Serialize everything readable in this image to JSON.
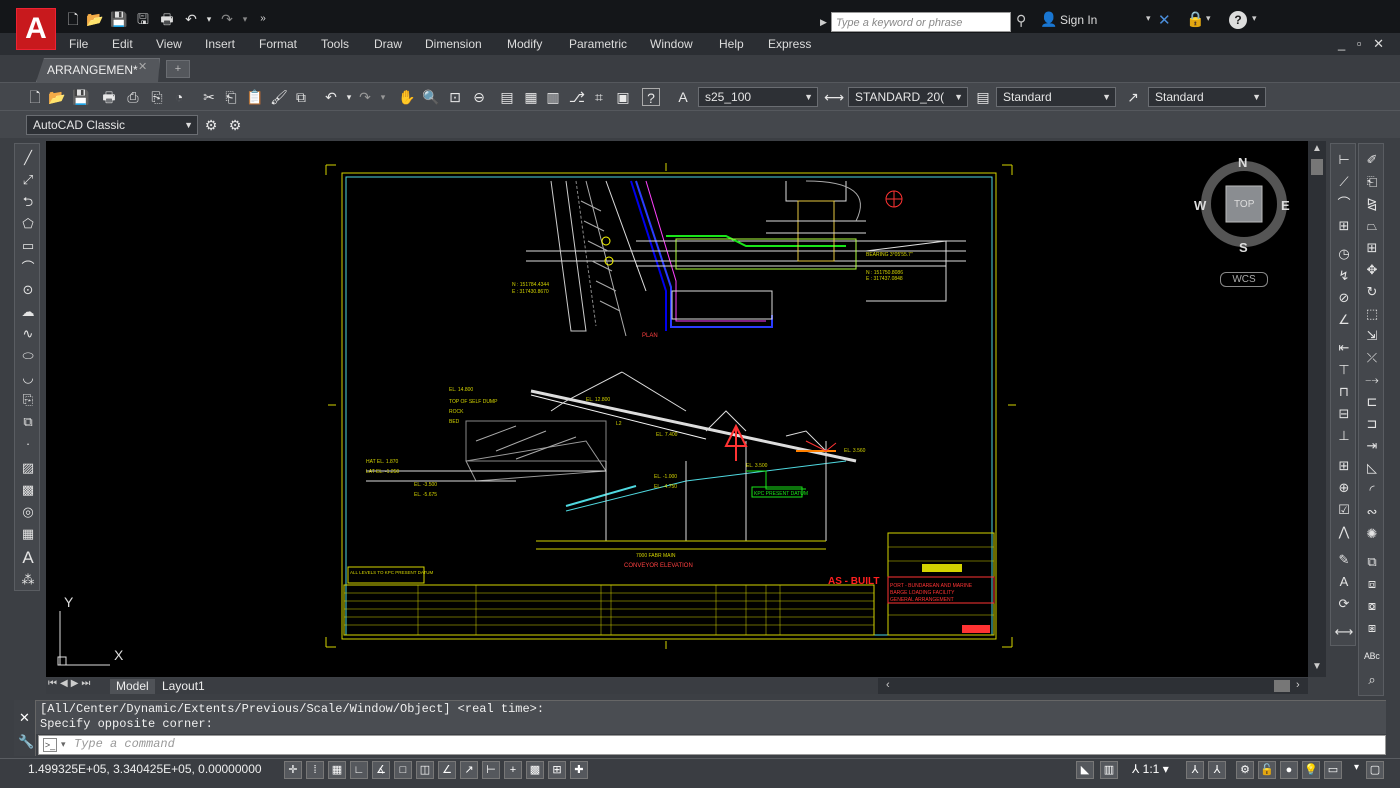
{
  "title_bar": {
    "app_logo": "A",
    "search_placeholder": "Type a keyword or phrase",
    "sign_in": "Sign In",
    "help": "?"
  },
  "menu": [
    "File",
    "Edit",
    "View",
    "Insert",
    "Format",
    "Tools",
    "Draw",
    "Dimension",
    "Modify",
    "Parametric",
    "Window",
    "Help",
    "Express"
  ],
  "tabs": {
    "document": "ARRANGEMEN*",
    "close": "✕"
  },
  "toolbar": {
    "layer_combo": "s25_100",
    "dimstyle_combo": "STANDARD_20(",
    "textstyle_combo": "Standard",
    "tablestyle_combo": "Standard",
    "workspace_combo": "AutoCAD Classic"
  },
  "viewcube": {
    "n": "N",
    "s": "S",
    "e": "E",
    "w": "W",
    "top": "TOP",
    "wcs": "WCS"
  },
  "ucs": {
    "x": "X",
    "y": "Y"
  },
  "layout_tabs": [
    "Model",
    "Layout1"
  ],
  "command": {
    "line1": "[All/Center/Dynamic/Extents/Previous/Scale/Window/Object] <real time>:",
    "line2": "Specify opposite corner:",
    "placeholder": "Type a command"
  },
  "status": {
    "coords": "1.499325E+05, 3.340425E+05, 0.00000000",
    "scale": "1:1"
  },
  "drawing": {
    "as_built": "AS - BUILT",
    "elevation_label": "CONVEYOR ELEVATION",
    "plan_label": "PLAN",
    "title_line1": "PORT - BUNDAREAN AND MARINE",
    "title_line2": "BARGE LOADING FACILITY",
    "title_line3": "GENERAL ARRANGEMENT",
    "note": "ALL LEVELS TO KPC PRESENT DATUM",
    "datum_box": "KPC PRESENT DATUM"
  }
}
